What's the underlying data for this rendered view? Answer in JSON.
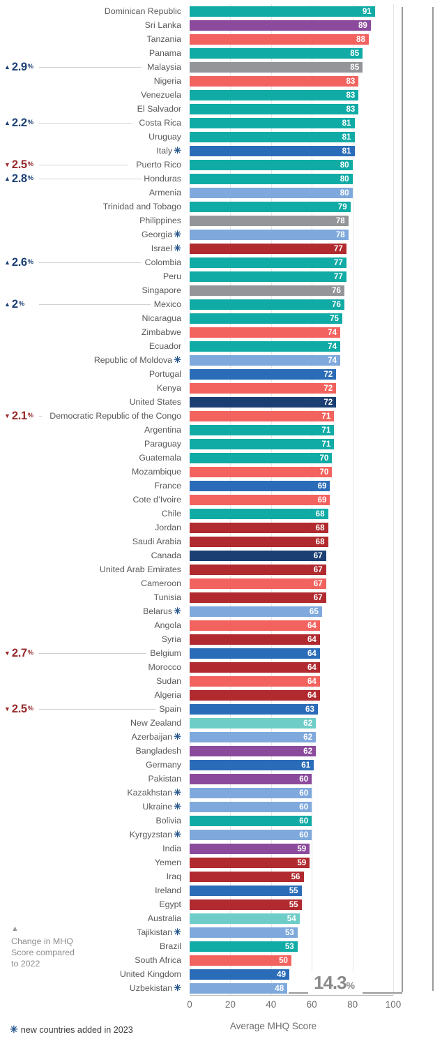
{
  "axis": {
    "x_title": "Average MHQ Score",
    "x_ticks": [
      "0",
      "20",
      "40",
      "60",
      "80",
      "100"
    ]
  },
  "legend": {
    "change_marker": "▲",
    "change_text_line1": "Change in MHQ",
    "change_text_line2": "Score compared",
    "change_text_line3": "to 2022",
    "new_star": "✳",
    "new_text": "new countries added in 2023"
  },
  "range_annotation": {
    "value": "14.3",
    "unit": "%"
  },
  "colors": {
    "teal": "#11aba6",
    "light_teal": "#6fcdc8",
    "purple": "#8b4a9c",
    "salmon": "#f2635f",
    "gray": "#939598",
    "blue": "#2b6cb8",
    "navy": "#1b3f73",
    "light_blue": "#7fa9dc",
    "dark_red": "#b02a2f",
    "grid": "#e6e6e6",
    "up": "#1b3f73",
    "down": "#962a2a",
    "star": "#23548c"
  },
  "chart_data": {
    "type": "bar",
    "orientation": "horizontal",
    "title": "",
    "xlabel": "Average MHQ Score",
    "ylabel": "",
    "xlim": [
      0,
      100
    ],
    "xticks": [
      0,
      20,
      40,
      60,
      80,
      100
    ],
    "grid": true,
    "legend_position": "bottom-left",
    "value_label_position": "inside-end",
    "categories": [
      "Dominican Republic",
      "Sri Lanka",
      "Tanzania",
      "Panama",
      "Malaysia",
      "Nigeria",
      "Venezuela",
      "El Salvador",
      "Costa Rica",
      "Uruguay",
      "Italy",
      "Puerto Rico",
      "Honduras",
      "Armenia",
      "Trinidad and Tobago",
      "Philippines",
      "Georgia",
      "Israel",
      "Colombia",
      "Peru",
      "Singapore",
      "Mexico",
      "Nicaragua",
      "Zimbabwe",
      "Ecuador",
      "Republic of Moldova",
      "Portugal",
      "Kenya",
      "United States",
      "Democratic Republic of the Congo",
      "Argentina",
      "Paraguay",
      "Guatemala",
      "Mozambique",
      "France",
      "Cote d’Ivoire",
      "Chile",
      "Jordan",
      "Saudi Arabia",
      "Canada",
      "United Arab Emirates",
      "Cameroon",
      "Tunisia",
      "Belarus",
      "Angola",
      "Syria",
      "Belgium",
      "Morocco",
      "Sudan",
      "Algeria",
      "Spain",
      "New Zealand",
      "Azerbaijan",
      "Bangladesh",
      "Germany",
      "Pakistan",
      "Kazakhstan",
      "Ukraine",
      "Bolivia",
      "Kyrgyzstan",
      "India",
      "Yemen",
      "Iraq",
      "Ireland",
      "Egypt",
      "Australia",
      "Tajikistan",
      "Brazil",
      "South Africa",
      "United Kingdom",
      "Uzbekistan"
    ],
    "values": [
      91,
      89,
      88,
      85,
      85,
      83,
      83,
      83,
      81,
      81,
      81,
      80,
      80,
      80,
      79,
      78,
      78,
      77,
      77,
      77,
      76,
      76,
      75,
      74,
      74,
      74,
      72,
      72,
      72,
      71,
      71,
      71,
      70,
      70,
      69,
      69,
      68,
      68,
      68,
      67,
      67,
      67,
      67,
      65,
      64,
      64,
      64,
      64,
      64,
      64,
      63,
      62,
      62,
      62,
      61,
      60,
      60,
      60,
      60,
      60,
      59,
      59,
      56,
      55,
      55,
      54,
      53,
      53,
      50,
      49,
      48
    ],
    "bar_colors": [
      "teal",
      "purple",
      "salmon",
      "teal",
      "gray",
      "salmon",
      "teal",
      "teal",
      "teal",
      "teal",
      "blue",
      "teal",
      "teal",
      "light_blue",
      "teal",
      "gray",
      "light_blue",
      "dark_red",
      "teal",
      "teal",
      "gray",
      "teal",
      "teal",
      "salmon",
      "teal",
      "light_blue",
      "blue",
      "salmon",
      "navy",
      "salmon",
      "teal",
      "teal",
      "teal",
      "salmon",
      "blue",
      "salmon",
      "teal",
      "dark_red",
      "dark_red",
      "navy",
      "dark_red",
      "salmon",
      "dark_red",
      "light_blue",
      "salmon",
      "dark_red",
      "blue",
      "dark_red",
      "salmon",
      "dark_red",
      "blue",
      "light_teal",
      "light_blue",
      "purple",
      "blue",
      "purple",
      "light_blue",
      "light_blue",
      "teal",
      "light_blue",
      "purple",
      "dark_red",
      "dark_red",
      "blue",
      "dark_red",
      "light_teal",
      "light_blue",
      "teal",
      "salmon",
      "blue",
      "light_blue"
    ],
    "new_in_2023": [
      "Italy",
      "Georgia",
      "Israel",
      "Republic of Moldova",
      "Belarus",
      "Azerbaijan",
      "Kazakhstan",
      "Ukraine",
      "Kyrgyzstan",
      "Tajikistan",
      "Uzbekistan"
    ],
    "changes": [
      {
        "country": "Malaysia",
        "value": "2.9",
        "unit": "%",
        "direction": "up"
      },
      {
        "country": "Costa Rica",
        "value": "2.2",
        "unit": "%",
        "direction": "up"
      },
      {
        "country": "Puerto Rico",
        "value": "2.5",
        "unit": "%",
        "direction": "down"
      },
      {
        "country": "Honduras",
        "value": "2.8",
        "unit": "%",
        "direction": "up"
      },
      {
        "country": "Colombia",
        "value": "2.6",
        "unit": "%",
        "direction": "up"
      },
      {
        "country": "Mexico",
        "value": "2",
        "unit": "%",
        "direction": "up"
      },
      {
        "country": "Democratic Republic of the Congo",
        "value": "2.1",
        "unit": "%",
        "direction": "down"
      },
      {
        "country": "Belgium",
        "value": "2.7",
        "unit": "%",
        "direction": "down"
      },
      {
        "country": "Spain",
        "value": "2.5",
        "unit": "%",
        "direction": "down"
      }
    ],
    "range_bracket": {
      "label": "14.3%",
      "from": "Dominican Republic",
      "to": "Uzbekistan"
    }
  }
}
